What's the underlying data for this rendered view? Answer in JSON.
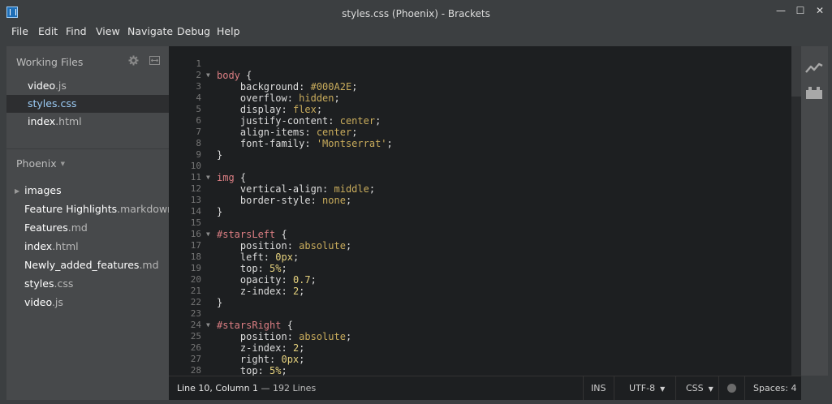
{
  "window": {
    "title": "styles.css (Phoenix) - Brackets",
    "minimize": "—",
    "maximize": "☐",
    "close": "✕"
  },
  "menu": [
    "File",
    "Edit",
    "Find",
    "View",
    "Navigate",
    "Debug",
    "Help"
  ],
  "working_files": {
    "header": "Working Files",
    "items": [
      {
        "name": "video",
        "ext": ".js",
        "selected": false
      },
      {
        "name": "styles",
        "ext": ".css",
        "selected": true
      },
      {
        "name": "index",
        "ext": ".html",
        "selected": false
      }
    ]
  },
  "project": {
    "title": "Phoenix",
    "items": [
      {
        "name": "images",
        "ext": "",
        "folder": true
      },
      {
        "name": "Feature Highlights",
        "ext": ".markdown"
      },
      {
        "name": "Features",
        "ext": ".md"
      },
      {
        "name": "index",
        "ext": ".html"
      },
      {
        "name": "Newly_added_features",
        "ext": ".md"
      },
      {
        "name": "styles",
        "ext": ".css"
      },
      {
        "name": "video",
        "ext": ".js"
      }
    ]
  },
  "code": [
    {
      "n": "1",
      "fold": false,
      "tokens": []
    },
    {
      "n": "2",
      "fold": true,
      "tokens": [
        [
          "sel",
          "body"
        ],
        [
          "brace",
          " {"
        ]
      ]
    },
    {
      "n": "3",
      "fold": false,
      "tokens": [
        [
          "prop",
          "    background"
        ],
        [
          "brace",
          ": "
        ],
        [
          "val",
          "#000A2E"
        ],
        [
          "brace",
          ";"
        ]
      ]
    },
    {
      "n": "4",
      "fold": false,
      "tokens": [
        [
          "prop",
          "    overflow"
        ],
        [
          "brace",
          ": "
        ],
        [
          "val",
          "hidden"
        ],
        [
          "brace",
          ";"
        ]
      ]
    },
    {
      "n": "5",
      "fold": false,
      "tokens": [
        [
          "prop",
          "    display"
        ],
        [
          "brace",
          ": "
        ],
        [
          "val",
          "flex"
        ],
        [
          "brace",
          ";"
        ]
      ]
    },
    {
      "n": "6",
      "fold": false,
      "tokens": [
        [
          "prop",
          "    justify-content"
        ],
        [
          "brace",
          ": "
        ],
        [
          "val",
          "center"
        ],
        [
          "brace",
          ";"
        ]
      ]
    },
    {
      "n": "7",
      "fold": false,
      "tokens": [
        [
          "prop",
          "    align-items"
        ],
        [
          "brace",
          ": "
        ],
        [
          "val",
          "center"
        ],
        [
          "brace",
          ";"
        ]
      ]
    },
    {
      "n": "8",
      "fold": false,
      "tokens": [
        [
          "prop",
          "    font-family"
        ],
        [
          "brace",
          ": "
        ],
        [
          "str",
          "'Montserrat'"
        ],
        [
          "brace",
          ";"
        ]
      ]
    },
    {
      "n": "9",
      "fold": false,
      "tokens": [
        [
          "brace",
          "}"
        ]
      ]
    },
    {
      "n": "10",
      "fold": false,
      "tokens": []
    },
    {
      "n": "11",
      "fold": true,
      "tokens": [
        [
          "sel",
          "img"
        ],
        [
          "brace",
          " {"
        ]
      ]
    },
    {
      "n": "12",
      "fold": false,
      "tokens": [
        [
          "prop",
          "    vertical-align"
        ],
        [
          "brace",
          ": "
        ],
        [
          "val",
          "middle"
        ],
        [
          "brace",
          ";"
        ]
      ]
    },
    {
      "n": "13",
      "fold": false,
      "tokens": [
        [
          "prop",
          "    border-style"
        ],
        [
          "brace",
          ": "
        ],
        [
          "val",
          "none"
        ],
        [
          "brace",
          ";"
        ]
      ]
    },
    {
      "n": "14",
      "fold": false,
      "tokens": [
        [
          "brace",
          "}"
        ]
      ]
    },
    {
      "n": "15",
      "fold": false,
      "tokens": []
    },
    {
      "n": "16",
      "fold": true,
      "tokens": [
        [
          "sel",
          "#starsLeft"
        ],
        [
          "brace",
          " {"
        ]
      ]
    },
    {
      "n": "17",
      "fold": false,
      "tokens": [
        [
          "prop",
          "    position"
        ],
        [
          "brace",
          ": "
        ],
        [
          "val",
          "absolute"
        ],
        [
          "brace",
          ";"
        ]
      ]
    },
    {
      "n": "18",
      "fold": false,
      "tokens": [
        [
          "prop",
          "    left"
        ],
        [
          "brace",
          ": "
        ],
        [
          "num",
          "0px"
        ],
        [
          "brace",
          ";"
        ]
      ]
    },
    {
      "n": "19",
      "fold": false,
      "tokens": [
        [
          "prop",
          "    top"
        ],
        [
          "brace",
          ": "
        ],
        [
          "num",
          "5%"
        ],
        [
          "brace",
          ";"
        ]
      ]
    },
    {
      "n": "20",
      "fold": false,
      "tokens": [
        [
          "prop",
          "    opacity"
        ],
        [
          "brace",
          ": "
        ],
        [
          "num",
          "0.7"
        ],
        [
          "brace",
          ";"
        ]
      ]
    },
    {
      "n": "21",
      "fold": false,
      "tokens": [
        [
          "prop",
          "    z-index"
        ],
        [
          "brace",
          ": "
        ],
        [
          "num",
          "2"
        ],
        [
          "brace",
          ";"
        ]
      ]
    },
    {
      "n": "22",
      "fold": false,
      "tokens": [
        [
          "brace",
          "}"
        ]
      ]
    },
    {
      "n": "23",
      "fold": false,
      "tokens": []
    },
    {
      "n": "24",
      "fold": true,
      "tokens": [
        [
          "sel",
          "#starsRight"
        ],
        [
          "brace",
          " {"
        ]
      ]
    },
    {
      "n": "25",
      "fold": false,
      "tokens": [
        [
          "prop",
          "    position"
        ],
        [
          "brace",
          ": "
        ],
        [
          "val",
          "absolute"
        ],
        [
          "brace",
          ";"
        ]
      ]
    },
    {
      "n": "26",
      "fold": false,
      "tokens": [
        [
          "prop",
          "    z-index"
        ],
        [
          "brace",
          ": "
        ],
        [
          "num",
          "2"
        ],
        [
          "brace",
          ";"
        ]
      ]
    },
    {
      "n": "27",
      "fold": false,
      "tokens": [
        [
          "prop",
          "    right"
        ],
        [
          "brace",
          ": "
        ],
        [
          "num",
          "0px"
        ],
        [
          "brace",
          ";"
        ]
      ]
    },
    {
      "n": "28",
      "fold": false,
      "tokens": [
        [
          "prop",
          "    top"
        ],
        [
          "brace",
          ": "
        ],
        [
          "num",
          "5%"
        ],
        [
          "brace",
          ";"
        ]
      ]
    }
  ],
  "status": {
    "cursor": "Line 10, Column 1",
    "lines": " — 192 Lines",
    "mode": "INS",
    "encoding": "UTF-8",
    "language": "CSS",
    "spaces_label": "Spaces:",
    "spaces_value": "4"
  },
  "icons": {
    "gear": "gear-icon",
    "split": "split-view-icon",
    "live_preview": "live-preview-icon",
    "extensions": "extension-manager-icon",
    "linter": "linter-status-icon"
  },
  "colors": {
    "accent": "#9bcbf5",
    "selector": "#dc7e83",
    "value": "#c9ac5c",
    "number": "#e6d27e"
  }
}
